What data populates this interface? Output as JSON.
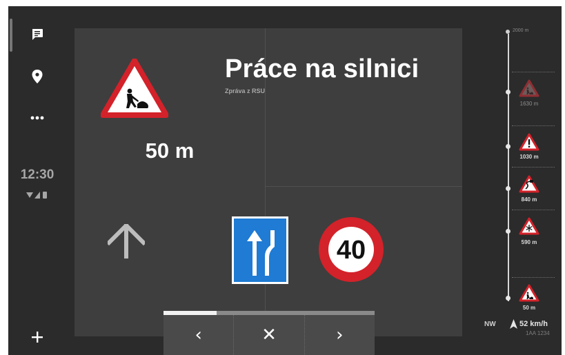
{
  "rail": {
    "clock": "12:30",
    "items": [
      "messages-icon",
      "location-pin-icon",
      "more-icon"
    ],
    "add_icon": "plus-icon"
  },
  "alert": {
    "title": "Práce na silnici",
    "subtitle": "Zpráva z RSU",
    "distance": "50 m",
    "sign": "road-works-sign",
    "direction_icon": "arrow-up-icon",
    "lane_sign": "lane-merge-sign",
    "speed_limit": "40"
  },
  "controls": {
    "prev_label": "‹",
    "close_label": "✕",
    "next_label": "›",
    "progress": 0.25
  },
  "timeline": {
    "top_label": "2000 m",
    "items": [
      {
        "distance": "1630 m",
        "sign": "road-works-sign-faded"
      },
      {
        "distance": "1030 m",
        "sign": "general-warning-sign"
      },
      {
        "distance": "840 m",
        "sign": "slippery-road-sign"
      },
      {
        "distance": "590 m",
        "sign": "ice-snow-sign"
      },
      {
        "distance": "50 m",
        "sign": "road-works-sign"
      }
    ],
    "heading": "NW",
    "speed": "52 km/h",
    "plate": "1AA 1234"
  },
  "colors": {
    "background": "#2b2b2b",
    "card": "#3e3e3e",
    "sign_red": "#d3222a",
    "sign_blue": "#1f7bd3"
  }
}
